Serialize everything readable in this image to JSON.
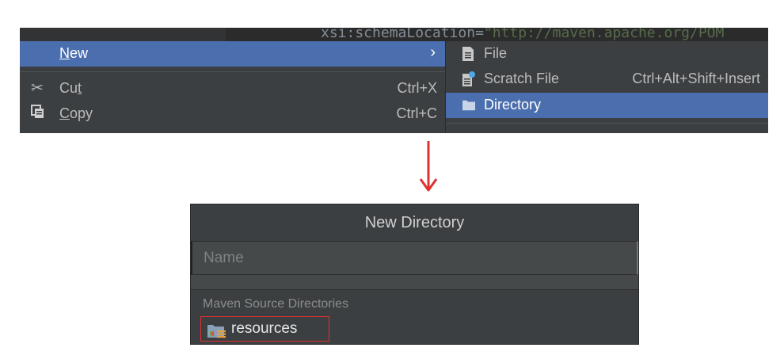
{
  "editor": {
    "code_line_prefix": "xsi:schemaLocation=",
    "code_line_string": "\"http://maven.apache.org/POM"
  },
  "context_menu": {
    "items": [
      {
        "accel": "N",
        "rest": "ew",
        "shortcut": "",
        "has_submenu": true,
        "icon": "none"
      },
      {
        "accel": "Cu",
        "rest": "t",
        "shortcut": "Ctrl+X",
        "icon": "scissors-icon"
      },
      {
        "accel": "C",
        "rest": "opy",
        "shortcut": "Ctrl+C",
        "icon": "copy-icon"
      }
    ]
  },
  "submenu": {
    "items": [
      {
        "label": "File",
        "shortcut": "",
        "icon": "file-icon"
      },
      {
        "label": "Scratch File",
        "shortcut": "Ctrl+Alt+Shift+Insert",
        "icon": "scratch-file-icon"
      },
      {
        "label": "Directory",
        "shortcut": "",
        "icon": "folder-icon",
        "selected": true
      }
    ]
  },
  "dialog": {
    "title": "New Directory",
    "name_placeholder": "Name",
    "section_header": "Maven Source Directories",
    "suggestion": "resources"
  },
  "colors": {
    "selection": "#4b6eaf",
    "menu_bg": "#3c3f41",
    "highlight_border": "#e03030",
    "arrow": "#e03030"
  }
}
